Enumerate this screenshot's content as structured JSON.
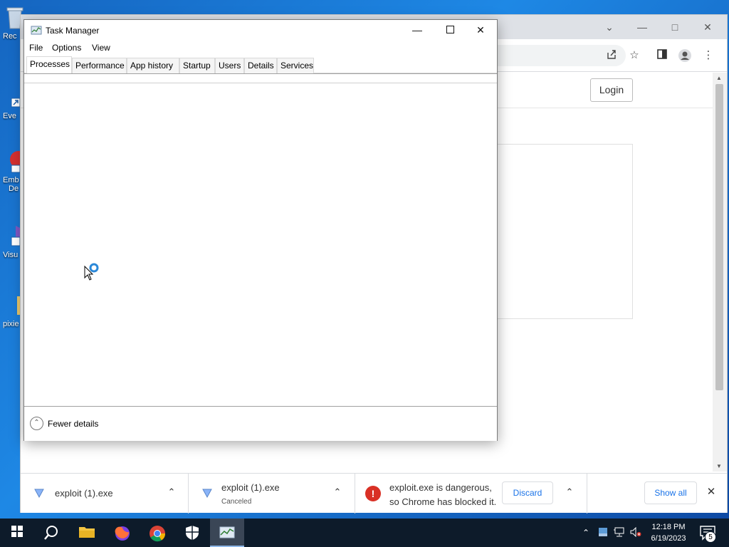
{
  "desktop": {
    "icons": [
      {
        "label": "Rec",
        "icon": "recycle-bin-icon"
      },
      {
        "label": "Eve",
        "icon": "shortcut-icon"
      },
      {
        "label": "Emb",
        "label2": "De",
        "icon": "shortcut-icon"
      },
      {
        "label": "Visu",
        "icon": "visual-studio-icon"
      },
      {
        "label": "pixie",
        "icon": "folder-icon"
      }
    ]
  },
  "chrome": {
    "page": {
      "login_label": "Login"
    },
    "downloads": [
      {
        "name": "exploit (1).exe",
        "status": ""
      },
      {
        "name": "exploit (1).exe",
        "status": "Canceled"
      }
    ],
    "danger": {
      "line1": "exploit.exe is dangerous,",
      "line2": "so Chrome has blocked it.",
      "discard_label": "Discard"
    },
    "show_all_label": "Show all"
  },
  "task_manager": {
    "title": "Task Manager",
    "menu": [
      "File",
      "Options",
      "View"
    ],
    "tabs": [
      "Processes",
      "Performance",
      "App history",
      "Startup",
      "Users",
      "Details",
      "Services"
    ],
    "active_tab": "Processes",
    "footer_label": "Fewer details"
  },
  "taskbar": {
    "clock_time": "12:18 PM",
    "clock_date": "6/19/2023",
    "notification_count": "5"
  },
  "colors": {
    "desktop": "#1565c0",
    "taskbar": "#0d1b2a",
    "chrome_link": "#1a73e8",
    "danger": "#d93025"
  }
}
